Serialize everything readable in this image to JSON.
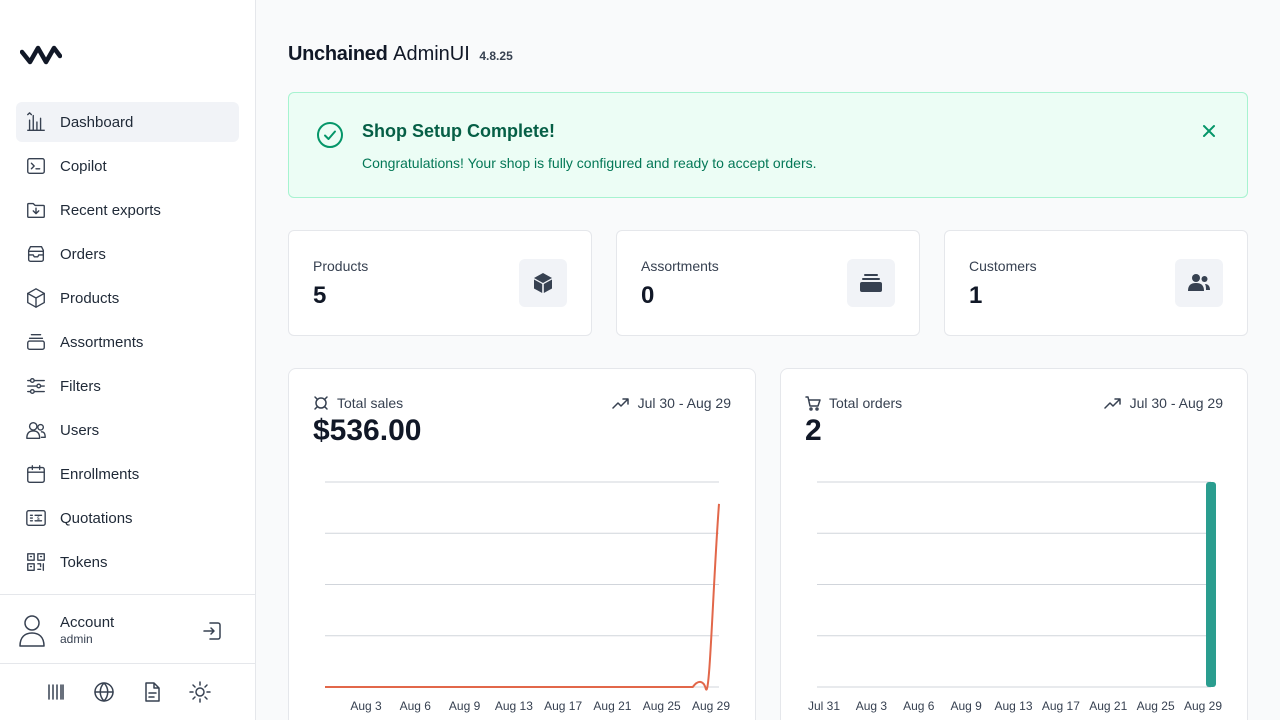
{
  "nav": [
    {
      "label": "Dashboard",
      "icon": "chart-bar-icon",
      "active": true
    },
    {
      "label": "Copilot",
      "icon": "terminal-icon"
    },
    {
      "label": "Recent exports",
      "icon": "folder-download-icon"
    },
    {
      "label": "Orders",
      "icon": "inbox-stack-icon"
    },
    {
      "label": "Products",
      "icon": "cube-icon"
    },
    {
      "label": "Assortments",
      "icon": "stack-icon"
    },
    {
      "label": "Filters",
      "icon": "sliders-icon"
    },
    {
      "label": "Users",
      "icon": "users-icon"
    },
    {
      "label": "Enrollments",
      "icon": "calendar-icon"
    },
    {
      "label": "Quotations",
      "icon": "receipt-icon"
    },
    {
      "label": "Tokens",
      "icon": "qr-code-icon"
    }
  ],
  "account": {
    "name": "Account",
    "role": "admin"
  },
  "header": {
    "brand": "Unchained",
    "app": "AdminUI",
    "version": "4.8.25"
  },
  "alert": {
    "title": "Shop Setup Complete!",
    "message": "Congratulations! Your shop is fully configured and ready to accept orders."
  },
  "stats": [
    {
      "label": "Products",
      "value": "5",
      "icon": "cube-icon"
    },
    {
      "label": "Assortments",
      "value": "0",
      "icon": "stack-icon"
    },
    {
      "label": "Customers",
      "value": "1",
      "icon": "users-icon"
    }
  ],
  "colors": {
    "sales_line": "#e2674a",
    "orders_bar": "#2a9d8f",
    "grid": "#d1d5db",
    "success": "#059669"
  },
  "chart_data": [
    {
      "type": "line",
      "title": "Total sales",
      "range": "Jul 30 - Aug 29",
      "total": "$536.00",
      "tick_labels": [
        "Aug 3",
        "Aug 6",
        "Aug 9",
        "Aug 13",
        "Aug 17",
        "Aug 21",
        "Aug 25",
        "Aug 29"
      ],
      "x": [
        0,
        1,
        2,
        3,
        4,
        5,
        6,
        7,
        8,
        9,
        10,
        11,
        12,
        13,
        14,
        15,
        16,
        17,
        18,
        19,
        20,
        21,
        22,
        23,
        24,
        25,
        26,
        27,
        28,
        29,
        30
      ],
      "y": [
        0,
        0,
        0,
        0,
        0,
        0,
        0,
        0,
        0,
        0,
        0,
        0,
        0,
        0,
        0,
        0,
        0,
        0,
        0,
        0,
        0,
        0,
        0,
        0,
        0,
        0,
        0,
        0,
        0,
        0,
        536
      ],
      "ylim": [
        0,
        600
      ],
      "grid": true
    },
    {
      "type": "bar",
      "title": "Total orders",
      "range": "Jul 30 - Aug 29",
      "total": "2",
      "tick_labels": [
        "Jul 31",
        "Aug 3",
        "Aug 6",
        "Aug 9",
        "Aug 13",
        "Aug 17",
        "Aug 21",
        "Aug 25",
        "Aug 29"
      ],
      "x": [
        0,
        1,
        2,
        3,
        4,
        5,
        6,
        7,
        8,
        9,
        10,
        11,
        12,
        13,
        14,
        15,
        16,
        17,
        18,
        19,
        20,
        21,
        22,
        23,
        24,
        25,
        26,
        27,
        28,
        29,
        30
      ],
      "y": [
        0,
        0,
        0,
        0,
        0,
        0,
        0,
        0,
        0,
        0,
        0,
        0,
        0,
        0,
        0,
        0,
        0,
        0,
        0,
        0,
        0,
        0,
        0,
        0,
        0,
        0,
        0,
        0,
        0,
        0,
        2
      ],
      "ylim": [
        0,
        2
      ],
      "grid": true
    }
  ]
}
